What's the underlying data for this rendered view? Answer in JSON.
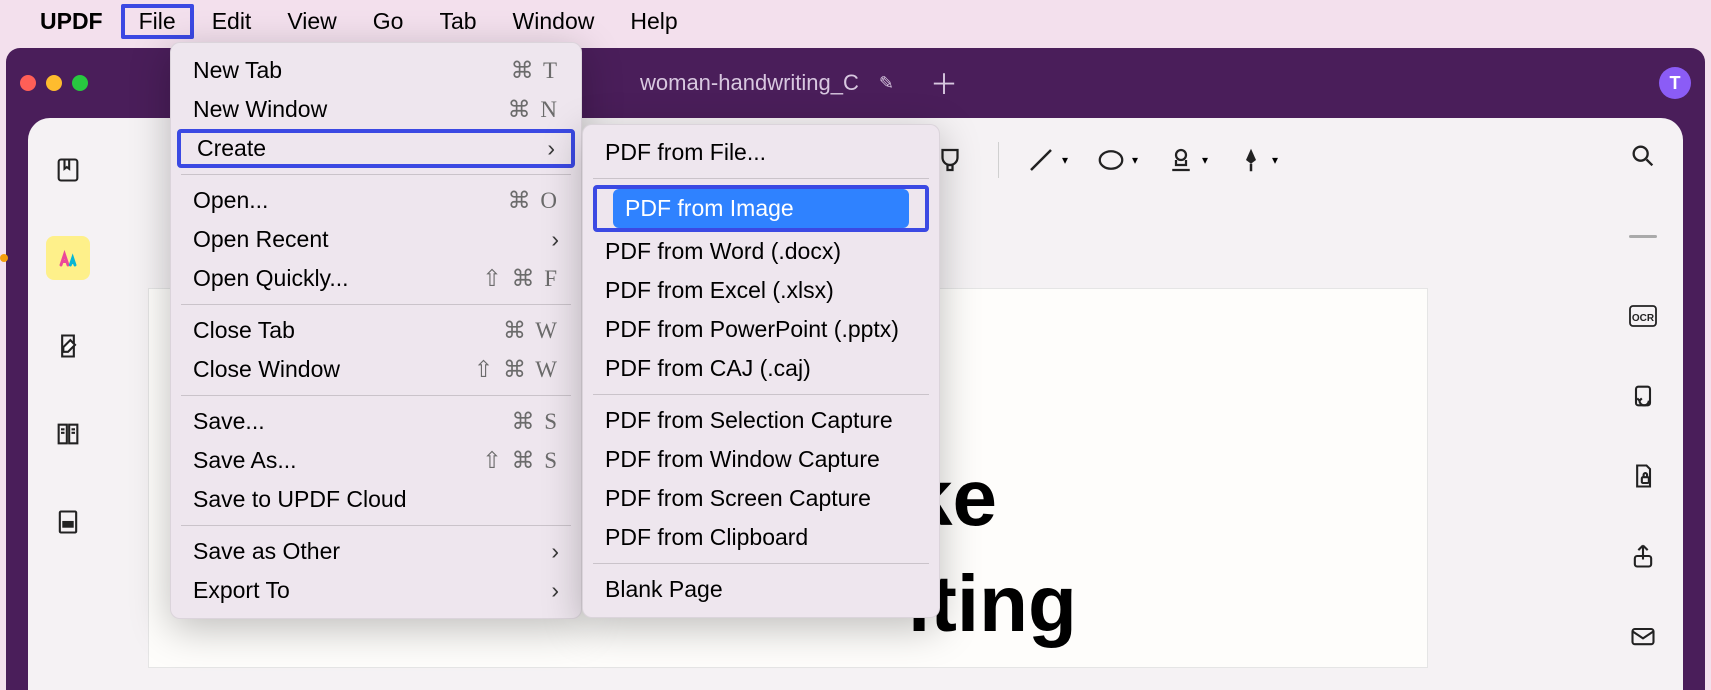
{
  "menubar": {
    "app": "UPDF",
    "items": [
      "File",
      "Edit",
      "View",
      "Go",
      "Tab",
      "Window",
      "Help"
    ],
    "active": "File"
  },
  "window": {
    "tab_title": "woman-handwriting_C",
    "profile_initial": "T"
  },
  "file_menu": {
    "groups": [
      [
        {
          "label": "New Tab",
          "shortcut": "⌘ T"
        },
        {
          "label": "New Window",
          "shortcut": "⌘ N"
        },
        {
          "label": "Create",
          "submenu": true,
          "boxed": true
        }
      ],
      [
        {
          "label": "Open...",
          "shortcut": "⌘ O"
        },
        {
          "label": "Open Recent",
          "submenu": true
        },
        {
          "label": "Open Quickly...",
          "shortcut": "⇧ ⌘ F"
        }
      ],
      [
        {
          "label": "Close Tab",
          "shortcut": "⌘ W"
        },
        {
          "label": "Close Window",
          "shortcut": "⇧ ⌘ W"
        }
      ],
      [
        {
          "label": "Save...",
          "shortcut": "⌘ S"
        },
        {
          "label": "Save As...",
          "shortcut": "⇧ ⌘ S"
        },
        {
          "label": "Save to UPDF Cloud"
        }
      ],
      [
        {
          "label": "Save as Other",
          "submenu": true
        },
        {
          "label": "Export To",
          "submenu": true
        }
      ]
    ]
  },
  "create_submenu": {
    "groups": [
      [
        {
          "label": "PDF from File..."
        }
      ],
      [
        {
          "label": "PDF from Image",
          "selected": true,
          "boxed": true
        },
        {
          "label": "PDF from Word (.docx)"
        },
        {
          "label": "PDF from Excel (.xlsx)"
        },
        {
          "label": "PDF from PowerPoint (.pptx)"
        },
        {
          "label": "PDF from CAJ (.caj)"
        }
      ],
      [
        {
          "label": "PDF from Selection Capture"
        },
        {
          "label": "PDF from Window Capture"
        },
        {
          "label": "PDF from Screen Capture"
        },
        {
          "label": "PDF from Clipboard"
        }
      ],
      [
        {
          "label": "Blank Page"
        }
      ]
    ]
  },
  "left_rail": {
    "items": [
      "bookmark",
      "highlighter",
      "edit-page",
      "thumbnails",
      "redact"
    ]
  },
  "right_rail": {
    "items": [
      "search",
      "minimize",
      "ocr",
      "rotate",
      "protect",
      "share",
      "mail"
    ]
  },
  "toolbar": {
    "items": [
      "highlighter",
      "divider",
      "line",
      "shape",
      "stamp",
      "signature"
    ]
  },
  "document": {
    "text_line1": "ke",
    "text_line2": "iting"
  }
}
